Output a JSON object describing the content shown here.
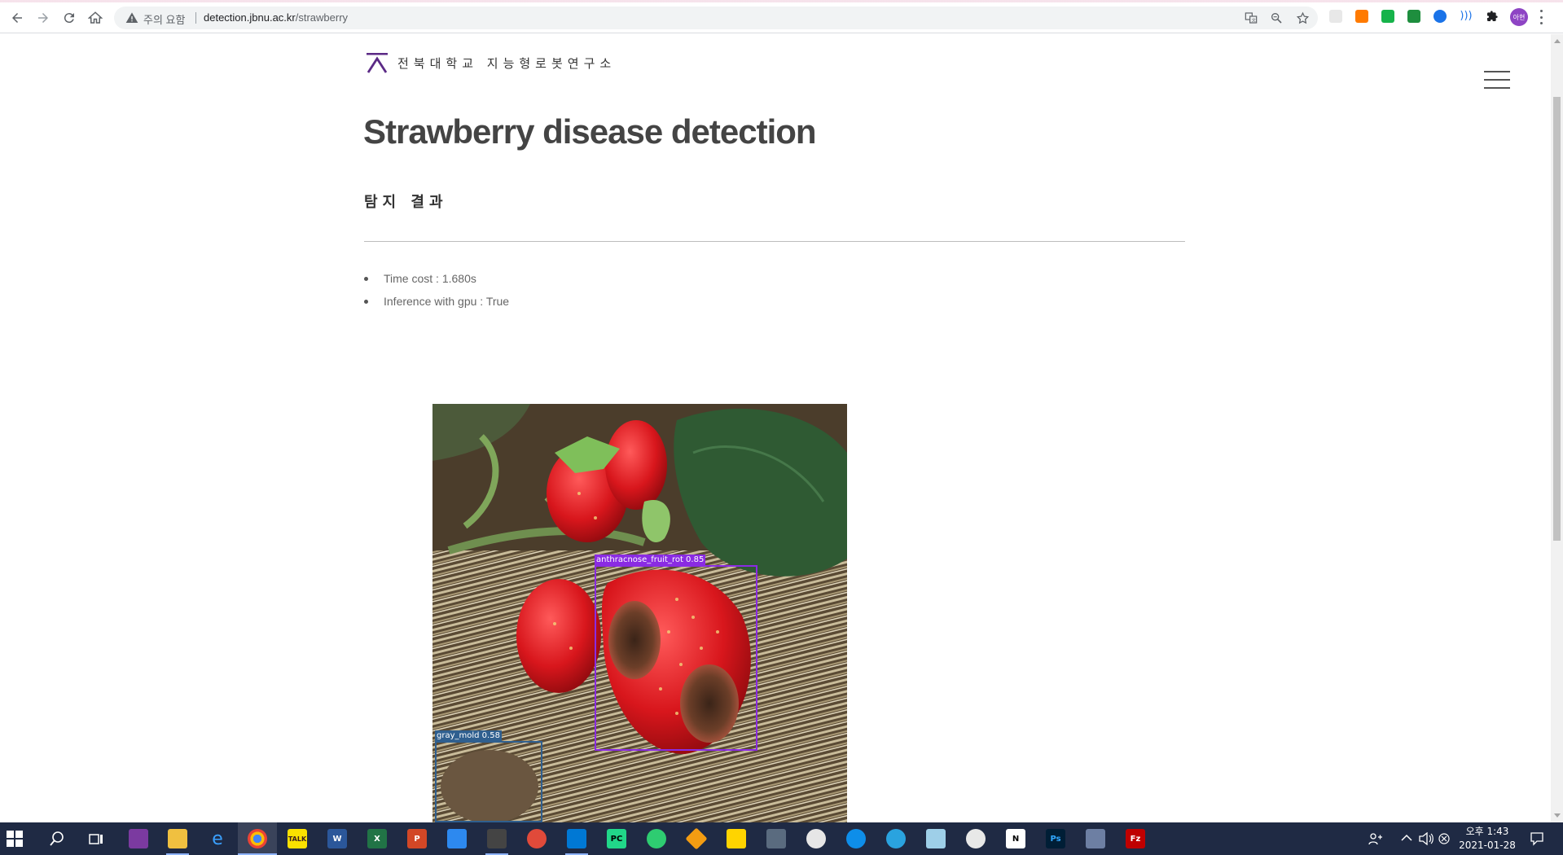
{
  "browser": {
    "security_warning": "주의 요함",
    "url_host": "detection.jbnu.ac.kr",
    "url_path": "/strawberry",
    "profile_label": "아현"
  },
  "site": {
    "logo_text": "전북대학교 지능형로봇연구소"
  },
  "page": {
    "title": "Strawberry disease detection",
    "subtitle": "탐지 결과",
    "info": [
      "Time cost : 1.680s",
      "Inference with gpu : True"
    ]
  },
  "result_image": {
    "detections": [
      {
        "label": "anthracnose_fruit_rot 0.85",
        "color": "#8a2be2"
      },
      {
        "label": "gray_mold 0.58",
        "color": "#2f5f8f"
      }
    ]
  },
  "taskbar": {
    "clock_time": "오후 1:43",
    "clock_date": "2021-01-28",
    "apps": [
      "start-icon",
      "search-icon",
      "task-view-icon",
      "app-icon",
      "file-explorer-icon",
      "edge-icon",
      "chrome-icon",
      "kakaotalk-icon",
      "word-icon",
      "excel-icon",
      "powerpoint-icon",
      "app-icon",
      "snipping-icon",
      "app-icon",
      "vscode-icon",
      "pycharm-icon",
      "app-icon",
      "app-icon",
      "sticky-notes-icon",
      "calculator-icon",
      "app-icon",
      "teamviewer-icon",
      "telegram-icon",
      "app-icon",
      "app-icon",
      "notion-icon",
      "photoshop-icon",
      "app-icon",
      "filezilla-icon"
    ]
  }
}
